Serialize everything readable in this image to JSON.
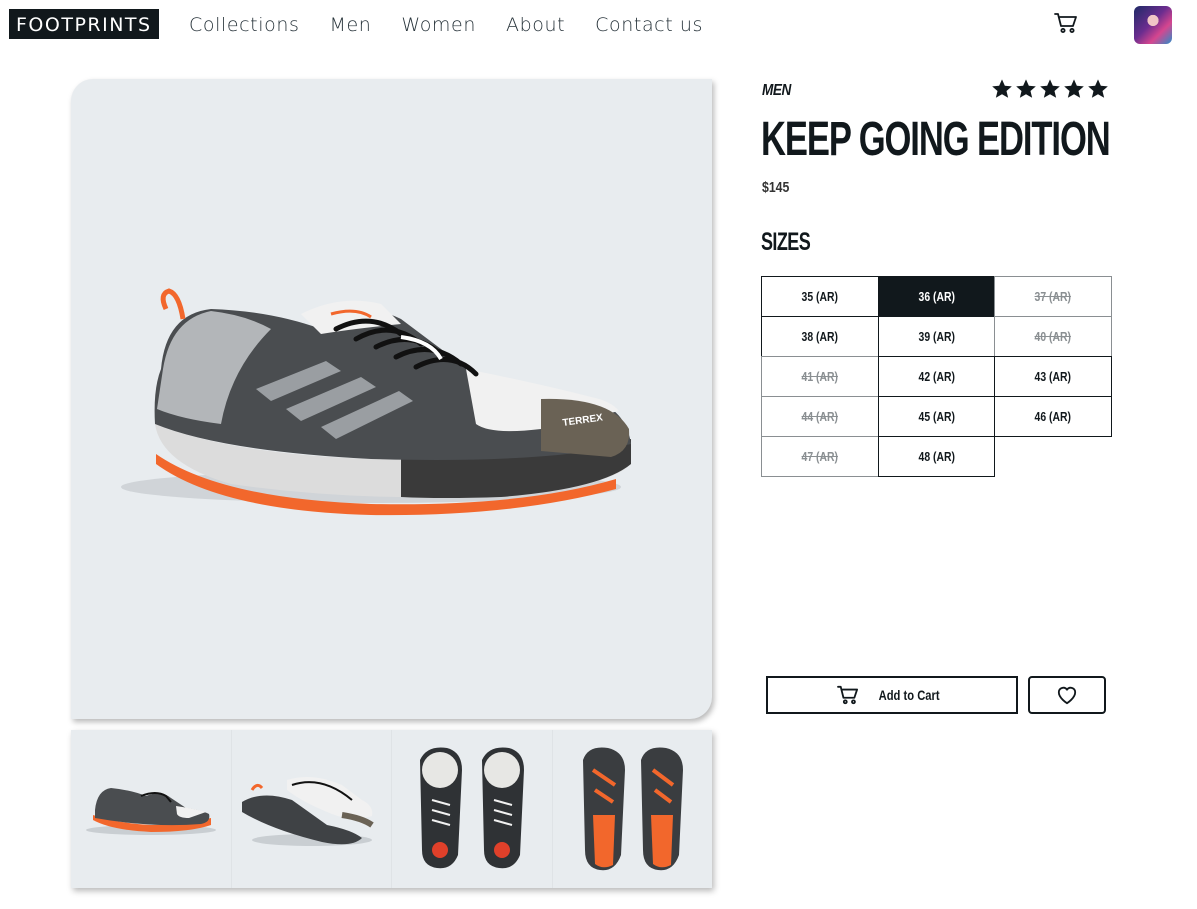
{
  "header": {
    "logo": "FOOTPRINTS",
    "nav": [
      {
        "label": "Collections"
      },
      {
        "label": "Men"
      },
      {
        "label": "Women"
      },
      {
        "label": "About"
      },
      {
        "label": "Contact us"
      }
    ],
    "cart_icon": "cart-icon",
    "avatar": "user-avatar"
  },
  "product": {
    "category": "MEN",
    "rating": 5,
    "rating_max": 5,
    "title": "KEEP GOING EDITION",
    "price": "$145",
    "sizes_heading": "SIZES",
    "sizes": [
      {
        "label": "35 (AR)",
        "state": "available"
      },
      {
        "label": "36 (AR)",
        "state": "selected"
      },
      {
        "label": "37 (AR)",
        "state": "unavailable"
      },
      {
        "label": "38 (AR)",
        "state": "available"
      },
      {
        "label": "39 (AR)",
        "state": "available"
      },
      {
        "label": "40 (AR)",
        "state": "unavailable"
      },
      {
        "label": "41 (AR)",
        "state": "unavailable"
      },
      {
        "label": "42 (AR)",
        "state": "available"
      },
      {
        "label": "43 (AR)",
        "state": "available"
      },
      {
        "label": "44 (AR)",
        "state": "unavailable"
      },
      {
        "label": "45 (AR)",
        "state": "available"
      },
      {
        "label": "46 (AR)",
        "state": "available"
      },
      {
        "label": "47 (AR)",
        "state": "unavailable"
      },
      {
        "label": "48 (AR)",
        "state": "available"
      }
    ],
    "add_to_cart": "Add to Cart",
    "wishlist_icon": "heart-icon",
    "brand_mark": "TERREX",
    "thumbnails": [
      "side view",
      "pair angled view",
      "top view",
      "sole view"
    ]
  },
  "colors": {
    "ink": "#11181c",
    "image_bg": "#e8ecef",
    "accent_orange": "#f2672c",
    "unavailable": "#8a8f92"
  }
}
